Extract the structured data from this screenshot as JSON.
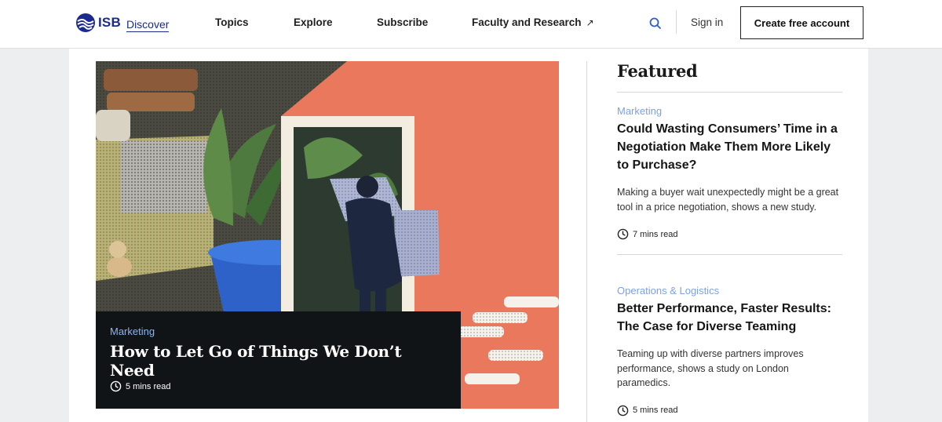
{
  "header": {
    "logo": {
      "brand": "ISB",
      "product": "Discover"
    },
    "nav": [
      {
        "label": "Topics"
      },
      {
        "label": "Explore"
      },
      {
        "label": "Subscribe"
      },
      {
        "label": "Faculty and Research",
        "icon": "external-arrow-icon"
      }
    ],
    "search_icon": "search-icon",
    "signin_label": "Sign in",
    "create_account_label": "Create free account"
  },
  "hero": {
    "category": "Marketing",
    "title": "How to Let Go of Things We Don’t Need",
    "read_time": "5 mins read"
  },
  "featured": {
    "heading": "Featured",
    "articles": [
      {
        "category": "Marketing",
        "title": "Could Wasting Consumers’ Time in a Negotiation Make Them More Likely to Purchase?",
        "description": "Making a buyer wait unexpectedly might be a great tool in a price negotiation, shows a new study.",
        "read_time": "7 mins read"
      },
      {
        "category": "Operations & Logistics",
        "title": "Better Performance, Faster Results: The Case for Diverse Teaming",
        "description": "Teaming up with diverse partners improves performance, shows a study on London paramedics.",
        "read_time": "5 mins read"
      }
    ]
  },
  "colors": {
    "brand": "#1b2a8f",
    "category": "#7aa2e6",
    "hero_background": "#e9785d",
    "hero_card": "#111417"
  }
}
